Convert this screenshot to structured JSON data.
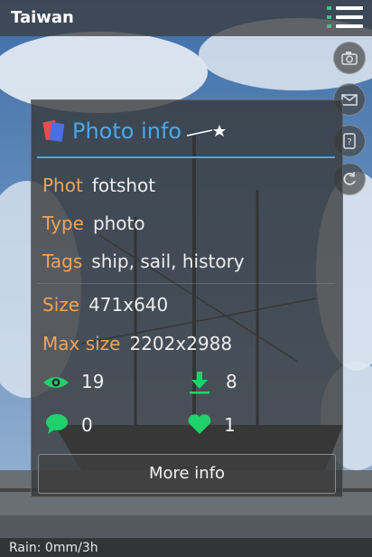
{
  "header": {
    "title": "Taiwan",
    "menu_icon": "menu-list-icon",
    "accent": "#2ec98a"
  },
  "side_buttons": [
    {
      "icon": "camera-icon"
    },
    {
      "icon": "mail-icon"
    },
    {
      "icon": "help-icon"
    },
    {
      "icon": "refresh-icon"
    }
  ],
  "photo_info": {
    "title": "Photo info",
    "title_color": "#4aa8e8",
    "label_color": "#f0a458",
    "fields": {
      "phot_label": "Phot",
      "phot_value": "fotshot",
      "type_label": "Type",
      "type_value": "photo",
      "tags_label": "Tags",
      "tags_value": "ship, sail, history",
      "size_label": "Size",
      "size_value": "471x640",
      "maxsize_label": "Max size",
      "maxsize_value": "2202x2988"
    },
    "stats": {
      "views": "19",
      "downloads": "8",
      "comments": "0",
      "likes": "1",
      "icon_color": "#1fd16a"
    },
    "more_button": "More info"
  },
  "footer": {
    "rain": "Rain: 0mm/3h"
  }
}
